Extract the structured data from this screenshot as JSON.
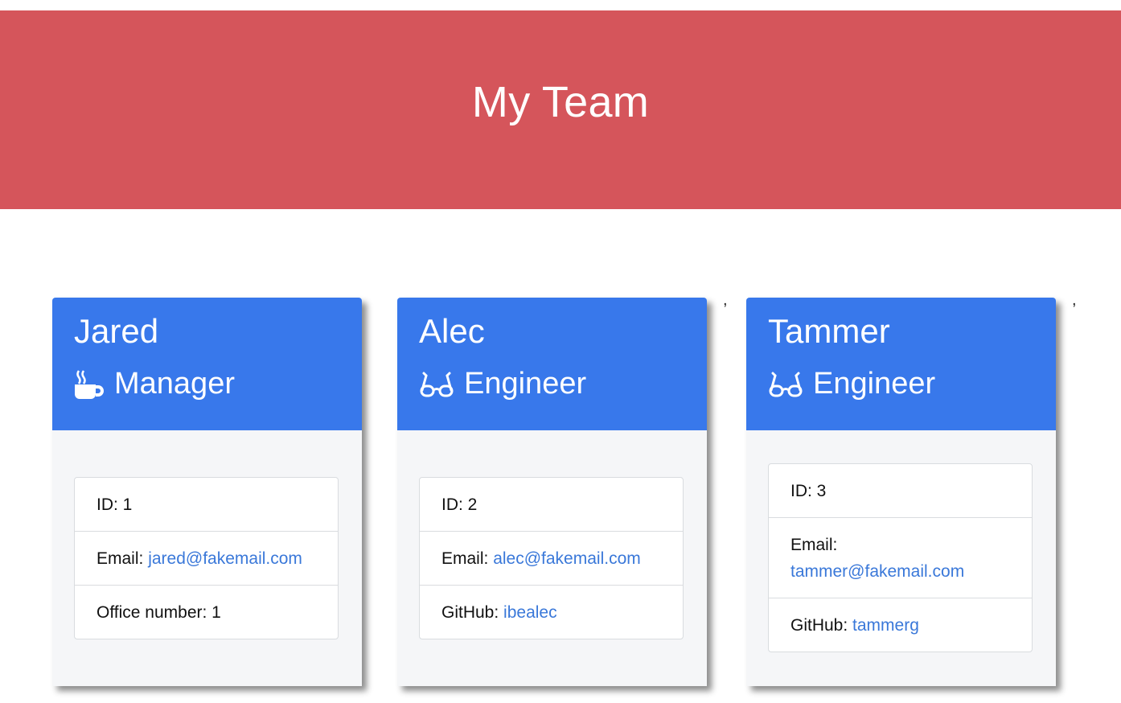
{
  "header": {
    "title": "My Team"
  },
  "colors": {
    "banner": "#d5555b",
    "card_header": "#3878eb",
    "link": "#3a78d9"
  },
  "employees": [
    {
      "name": "Jared",
      "role": "Manager",
      "role_icon": "mug-hot-icon",
      "id_text": "ID: 1",
      "email_label": "Email:",
      "email": "jared@fakemail.com",
      "extra_label": "Office number: 1",
      "extra_value": ""
    },
    {
      "name": "Alec",
      "role": "Engineer",
      "role_icon": "glasses-icon",
      "id_text": "ID: 2",
      "email_label": "Email:",
      "email": "alec@fakemail.com",
      "extra_label": "GitHub:",
      "extra_value": "ibealec"
    },
    {
      "name": "Tammer",
      "role": "Engineer",
      "role_icon": "glasses-icon",
      "id_text": "ID: 3",
      "email_label": "Email:",
      "email": "tammer@fakemail.com",
      "extra_label": "GitHub:",
      "extra_value": "tammerg"
    }
  ],
  "stray_marks": [
    ",",
    ","
  ]
}
